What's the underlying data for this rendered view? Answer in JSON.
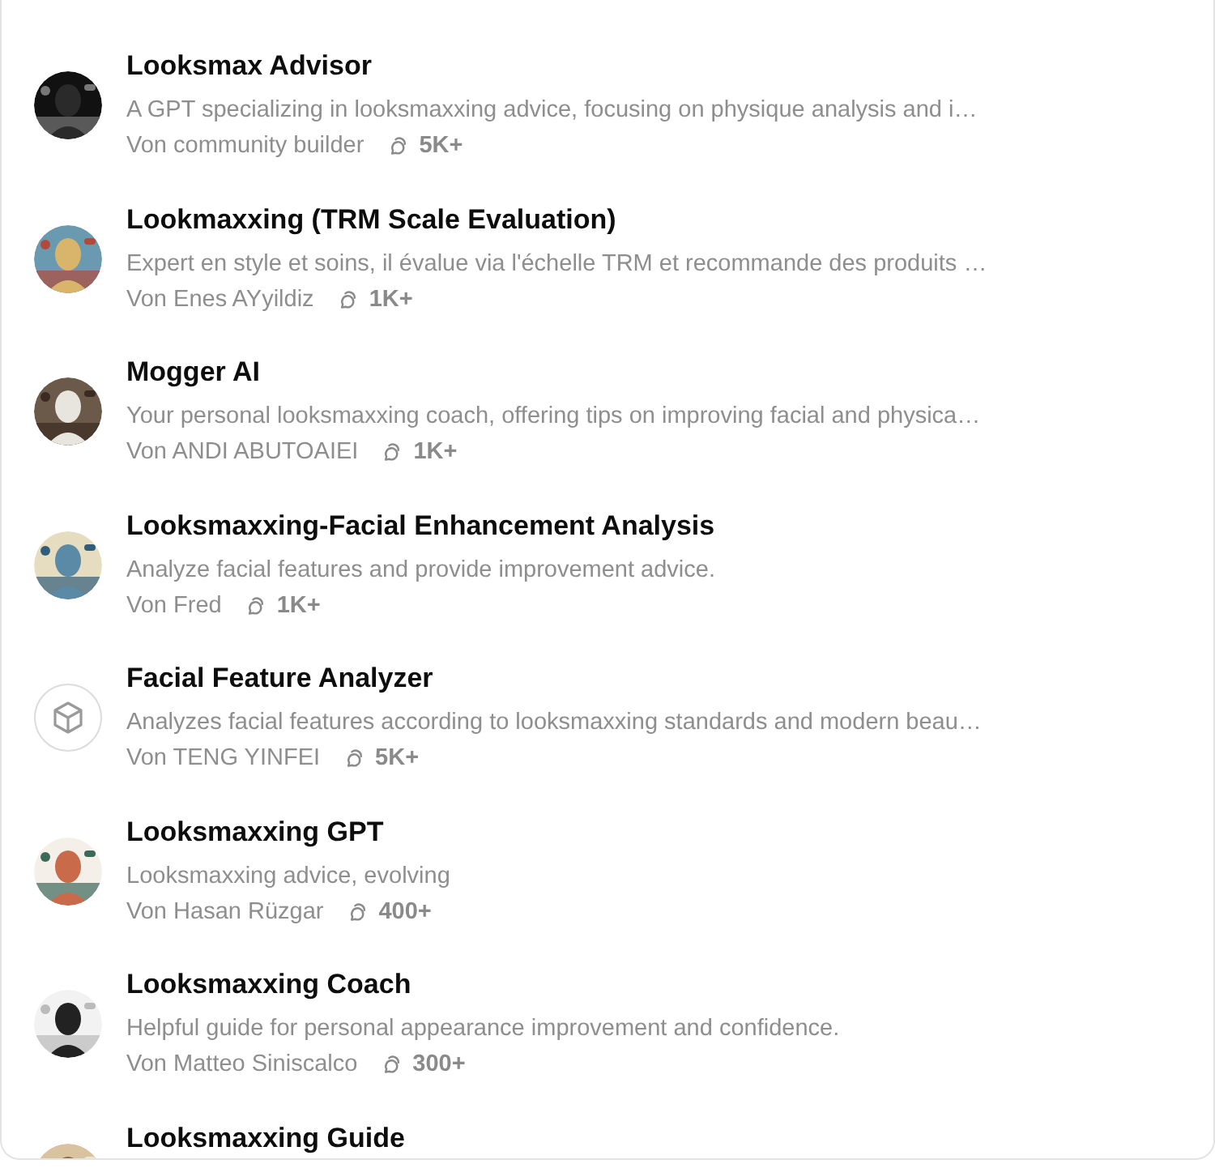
{
  "gpts": [
    {
      "title": "Looksmax Advisor",
      "description": "A GPT specializing in looksmaxxing advice, focusing on physique analysis and i…",
      "author": "Von community builder",
      "chats": "5K+"
    },
    {
      "title": "Lookmaxxing (TRM Scale Evaluation)",
      "description": "Expert en style et soins, il évalue via l'échelle TRM et recommande des produits …",
      "author": "Von Enes AYyildiz",
      "chats": "1K+"
    },
    {
      "title": "Mogger AI",
      "description": "Your personal looksmaxxing coach, offering tips on improving facial and physica…",
      "author": "Von ANDI ABUTOAIEI",
      "chats": "1K+"
    },
    {
      "title": "Looksmaxxing-Facial Enhancement Analysis",
      "description": "Analyze facial features and provide improvement advice.",
      "author": "Von Fred",
      "chats": "1K+"
    },
    {
      "avatar": {
        "kind": "cube"
      },
      "title": "Facial Feature Analyzer",
      "description": "Analyzes facial features according to looksmaxxing standards and modern beau…",
      "author": "Von TENG YINFEI",
      "chats": "5K+"
    },
    {
      "title": "Looksmaxxing GPT",
      "description": "Looksmaxxing advice, evolving",
      "author": "Von Hasan Rüzgar",
      "chats": "400+"
    },
    {
      "title": "Looksmaxxing Coach",
      "description": "Helpful guide for personal appearance improvement and confidence.",
      "author": "Von Matteo Siniscalco",
      "chats": "300+"
    },
    {
      "title": "Looksmaxxing Guide"
    }
  ]
}
